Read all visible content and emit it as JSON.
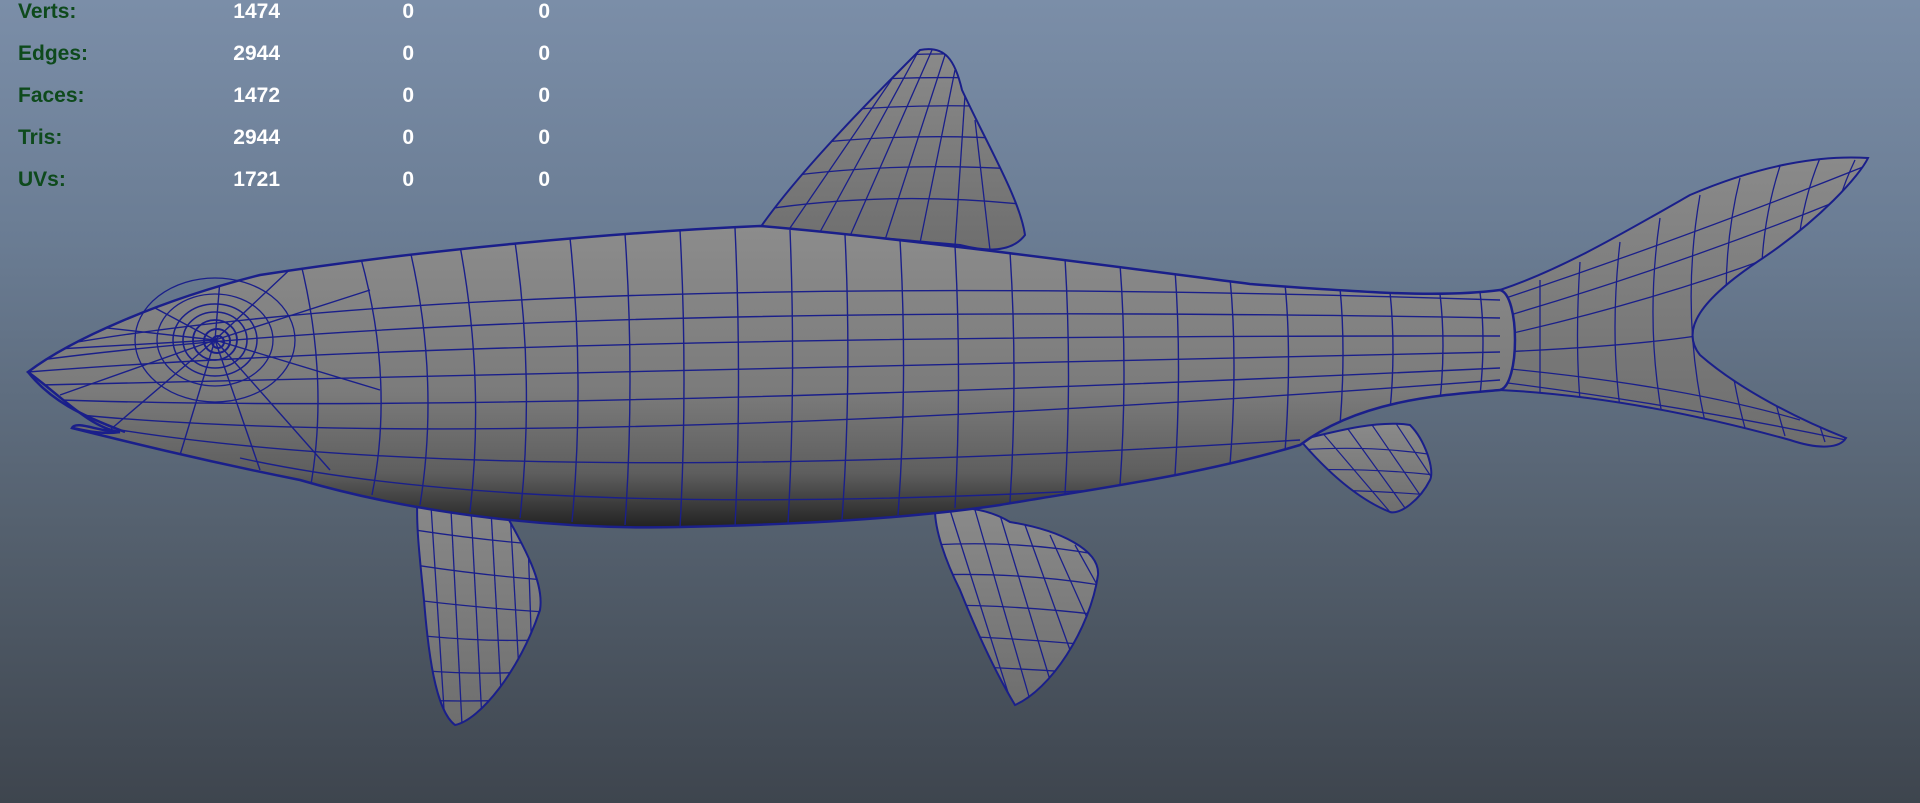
{
  "hud": {
    "rows": [
      {
        "label": "Verts:",
        "values": [
          "1474",
          "0",
          "0"
        ]
      },
      {
        "label": "Edges:",
        "values": [
          "2944",
          "0",
          "0"
        ]
      },
      {
        "label": "Faces:",
        "values": [
          "1472",
          "0",
          "0"
        ]
      },
      {
        "label": "Tris:",
        "values": [
          "2944",
          "0",
          "0"
        ]
      },
      {
        "label": "UVs:",
        "values": [
          "1721",
          "0",
          "0"
        ]
      }
    ]
  },
  "colors": {
    "label_text": "#0e4a1c",
    "value_text": "#ffffff",
    "wireframe": "#1a1f8a",
    "mesh_shade": "#7a7a7a"
  },
  "model": {
    "subject": "fish"
  }
}
